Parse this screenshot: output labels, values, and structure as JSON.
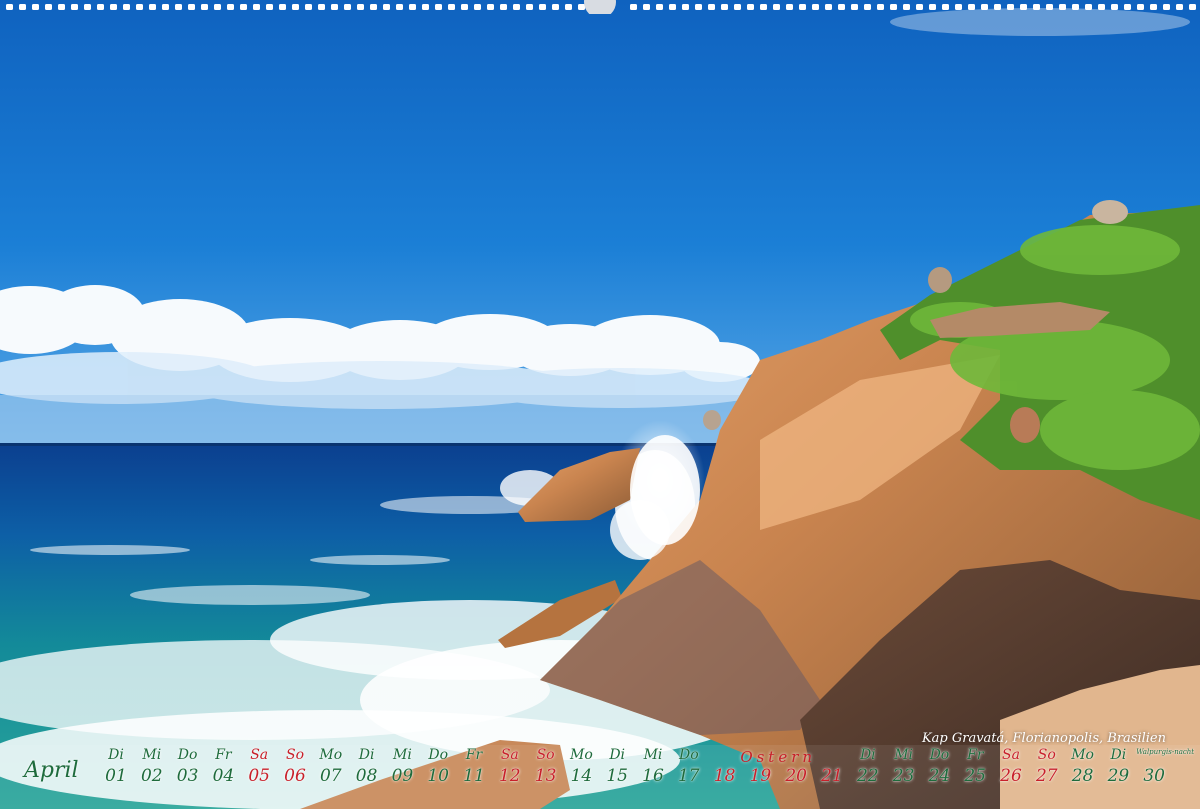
{
  "caption": "Kap Gravatá, Florianopolis, Brasilien",
  "month": "April",
  "holiday": {
    "label": "Ostern",
    "from_index": 17,
    "to_index": 20
  },
  "days": [
    {
      "wd": "Di",
      "num": "01",
      "weekend": false
    },
    {
      "wd": "Mi",
      "num": "02",
      "weekend": false
    },
    {
      "wd": "Do",
      "num": "03",
      "weekend": false
    },
    {
      "wd": "Fr",
      "num": "04",
      "weekend": false
    },
    {
      "wd": "Sa",
      "num": "05",
      "weekend": true
    },
    {
      "wd": "So",
      "num": "06",
      "weekend": true
    },
    {
      "wd": "Mo",
      "num": "07",
      "weekend": false
    },
    {
      "wd": "Di",
      "num": "08",
      "weekend": false
    },
    {
      "wd": "Mi",
      "num": "09",
      "weekend": false
    },
    {
      "wd": "Do",
      "num": "10",
      "weekend": false
    },
    {
      "wd": "Fr",
      "num": "11",
      "weekend": false
    },
    {
      "wd": "Sa",
      "num": "12",
      "weekend": true
    },
    {
      "wd": "So",
      "num": "13",
      "weekend": true
    },
    {
      "wd": "Mo",
      "num": "14",
      "weekend": false
    },
    {
      "wd": "Di",
      "num": "15",
      "weekend": false
    },
    {
      "wd": "Mi",
      "num": "16",
      "weekend": false
    },
    {
      "wd": "Do",
      "num": "17",
      "weekend": false
    },
    {
      "wd": "",
      "num": "18",
      "weekend": true
    },
    {
      "wd": "",
      "num": "19",
      "weekend": true
    },
    {
      "wd": "",
      "num": "20",
      "weekend": true
    },
    {
      "wd": "",
      "num": "21",
      "weekend": true
    },
    {
      "wd": "Di",
      "num": "22",
      "weekend": false
    },
    {
      "wd": "Mi",
      "num": "23",
      "weekend": false
    },
    {
      "wd": "Do",
      "num": "24",
      "weekend": false
    },
    {
      "wd": "Fr",
      "num": "25",
      "weekend": false
    },
    {
      "wd": "Sa",
      "num": "26",
      "weekend": true
    },
    {
      "wd": "So",
      "num": "27",
      "weekend": true
    },
    {
      "wd": "Mo",
      "num": "28",
      "weekend": false
    },
    {
      "wd": "Di",
      "num": "29",
      "weekend": false
    },
    {
      "wd": "Walpurgis-nacht",
      "num": "30",
      "weekend": false,
      "small": true
    }
  ]
}
